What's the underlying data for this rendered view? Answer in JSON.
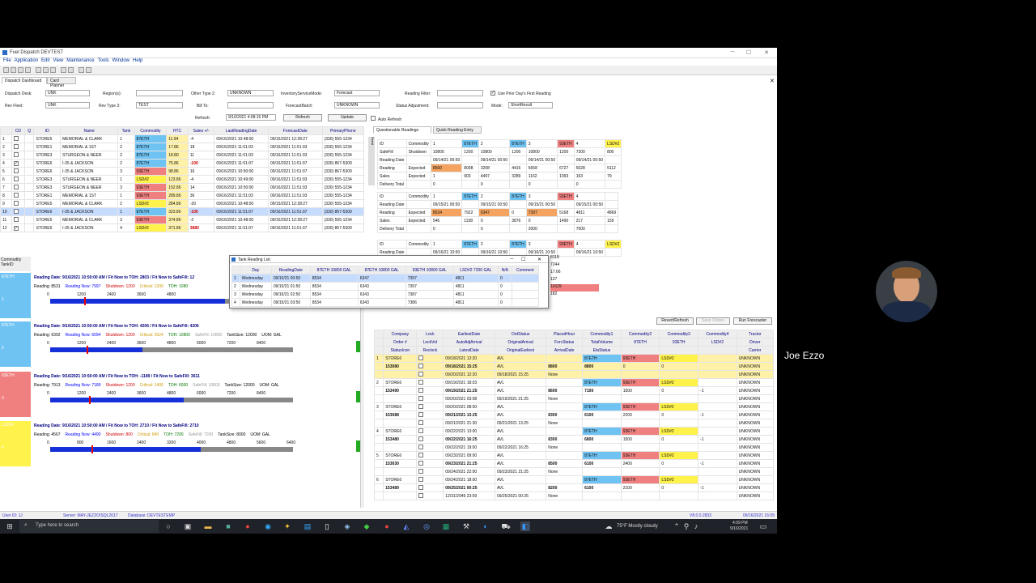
{
  "window": {
    "title": "Fuel Dispatch DEVTEST"
  },
  "menu": [
    "File",
    "Application",
    "Edit",
    "View",
    "Maintenance",
    "Tools",
    "Window",
    "Help"
  ],
  "doc_tabs": [
    "Dispatch Dashboard",
    "Card Planner"
  ],
  "filters": {
    "dispatch_desk_label": "Dispatch Desk:",
    "dispatch_desk_value": "UNK",
    "region_label": "Region(s):",
    "other_type_label": "Other Type 2:",
    "other_type_value": "UNKNOWN",
    "inventory_mode_label": "InventoryServiceMode:",
    "inventory_mode_value": "Forecast",
    "reading_filter_label": "Reading Filter:",
    "use_prior_label": "Use Prior Day's First Reading",
    "rev_fleet_label": "Rev Fleet:",
    "rev_fleet_value": "UNK",
    "rev_type_label": "Rev Type 3:",
    "rev_type_value": "TEST",
    "bill_to_label": "Bill To:",
    "forecast_batch_label": "ForecastBatch:",
    "forecast_batch_value": "UNKNOWN",
    "status_adj_label": "Status Adjustment:",
    "mode_label": "Mode:",
    "mode_value": "ShortResult",
    "refresh_label": "Refresh:",
    "refresh_value": "9/16/2021 4:08:15 PM",
    "refresh_button": "Refresh",
    "update_button": "Update",
    "auto_refresh_label": "Auto Refresh"
  },
  "tank_grid": {
    "headers": [
      "CD",
      "Q",
      "ID",
      "Name",
      "Tank",
      "Commodity",
      "HTC",
      "Sales +/-",
      "LastReadingDate",
      "ForecastDate",
      "PrimaryPhone"
    ],
    "rows": [
      [
        "1",
        "STORE5",
        "MEMORIAL & CLARK",
        "1",
        "87ETH",
        "11.94",
        "-4",
        "09/16/2021 10:48:00",
        "09/15/2021 12:28:27",
        "(330) 555-1234"
      ],
      [
        "2",
        "STORE1",
        "MEMORIAL & 1ST",
        "2",
        "87ETH",
        "17.86",
        "18",
        "09/16/2021 11:51:03",
        "09/16/2021 11:51:03",
        "(330) 555-1234"
      ],
      [
        "3",
        "STORE3",
        "STURGEON & NEER",
        "2",
        "87ETH",
        "18.80",
        "11",
        "09/16/2021 11:51:03",
        "09/16/2021 11:51:03",
        "(330) 555-1234"
      ],
      [
        "4",
        "STORE6",
        "I-35 & JACKSON",
        "2",
        "87ETH",
        "75.86",
        "-100",
        "09/16/2021 11:51:07",
        "09/16/2021 11:51:07",
        "(330) 867-5309"
      ],
      [
        "5",
        "STORE6",
        "I-35 & JACKSON",
        "3",
        "93ETH",
        "98.86",
        "16",
        "09/16/2021 10:50:00",
        "09/16/2021 11:51:07",
        "(330) 867-5309"
      ],
      [
        "6",
        "STORE3",
        "STURGEON & NEER",
        "1",
        "LSD#2",
        "123.86",
        "-4",
        "09/16/2021 10:49:00",
        "09/16/2021 11:51:03",
        "(330) 555-1234"
      ],
      [
        "7",
        "STORE3",
        "STURGEON & NEER",
        "3",
        "93ETH",
        "152.86",
        "14",
        "09/16/2021 10:50:00",
        "09/16/2021 11:51:03",
        "(330) 555-1234"
      ],
      [
        "8",
        "STORE1",
        "MEMORIAL & 1ST",
        "1",
        "93ETH",
        "289.86",
        "36",
        "09/16/2021 11:51:03",
        "09/16/2021 11:51:03",
        "(330) 555-1234"
      ],
      [
        "9",
        "STORE5",
        "MEMORIAL & CLARK",
        "2",
        "LSD#2",
        "284.86",
        "-20",
        "09/16/2021 10:48:00",
        "09/15/2021 12:28:27",
        "(330) 555-1234"
      ],
      [
        "10",
        "STORE6",
        "I-35 & JACKSON",
        "1",
        "87ETH",
        "323.86",
        "-100",
        "09/16/2021 11:51:07",
        "09/16/2021 11:51:07",
        "(330) 867-5309"
      ],
      [
        "11",
        "STORE5",
        "MEMORIAL & CLARK",
        "3",
        "93ETH",
        "374.86",
        "-2",
        "09/16/2021 10:48:00",
        "09/15/2021 12:28:27",
        "(330) 555-1234"
      ],
      [
        "12",
        "STORE6",
        "I-35 & JACKSON",
        "4",
        "LSD#2",
        "371.86",
        "3880",
        "09/16/2021 11:51:07",
        "09/16/2021 11:51:07",
        "(330) 867-5309"
      ]
    ]
  },
  "tanks": [
    {
      "id": "87ETH",
      "num": "1",
      "line1": "Reading Date: 9/16/2021 10:50:00 AM  /  Fit Now to TOH: 2803  /  Fit Now to SafeFill: 12",
      "line2a": "Reading: 8531",
      "line2b": "Reading Now: 7997",
      "line2c": "Shutdown: 1200",
      "line2d": "Critical: 1200",
      "line2e": "TOH: 1080",
      "ticks": [
        "0",
        "1200",
        "2400",
        "3600",
        "4800"
      ],
      "fill": 0.72
    },
    {
      "id": "87ETH",
      "num": "2",
      "line1": "Reading Date: 9/16/2021 10:50:00 AM  /  Fit Now to TOH: 4206  /  Fit Now to SafeFill: 4206",
      "line2a": "Reading: 6302",
      "line2b": "Reading Now: 6094",
      "line2c": "Shutdown: 1200",
      "line2d": "Critical: 2624",
      "line2e": "TOH: 10800",
      "line2f": "SafeFill: 10800",
      "line2g": "TankSize: 12000",
      "line2h": "UOM: GAL",
      "ticks": [
        "0",
        "1200",
        "2400",
        "3600",
        "4800",
        "6000",
        "7200",
        "8400"
      ],
      "fill": 0.38
    },
    {
      "id": "93ETH",
      "num": "3",
      "line1": "Reading Date: 9/16/2021 10:50:00 AM  /  Fit Now to TOH: -1189  /  Fit Now to SafeFill: 3611",
      "line2a": "Reading: 7913",
      "line2b": "Reading Now: 7189",
      "line2c": "Shutdown: 1200",
      "line2d": "Critical: 1400",
      "line2e": "TOH: 6000",
      "line2f": "SafeFill: 10800",
      "line2g": "TankSize: 12000",
      "line2h": "UOM: GAL",
      "ticks": [
        "0",
        "1200",
        "2400",
        "3600",
        "4800",
        "6000",
        "7200",
        "8400"
      ],
      "fill": 0.55
    },
    {
      "id": "LSD#2",
      "num": "4",
      "line1": "Reading Date: 9/16/2021 10:50:00 AM  /  Fit Now to TOH: 2710  /  Fit Now to SafeFill: 2710",
      "line2a": "Reading: 4567",
      "line2b": "Reading Now: 4490",
      "line2c": "Shutdown: 800",
      "line2d": "Critical: 840",
      "line2e": "TOH: 7200",
      "line2f": "SafeFill: 7200",
      "line2g": "TankSize: 8000",
      "line2h": "UOM: GAL",
      "ticks": [
        "0",
        "800",
        "1600",
        "2400",
        "3200",
        "4000",
        "4800",
        "5600",
        "6400"
      ],
      "fill": 0.62
    }
  ],
  "tank_side_header": {
    "commodity": "Commodity",
    "tank_id": "TankID"
  },
  "qr_tabs": [
    "Questionable Readings",
    "Quick Reading Entry"
  ],
  "qr_blocks": [
    {
      "labels": [
        "ID",
        "SafeFill",
        "Reading Date",
        "Reading",
        "Sales",
        "Delivery Total"
      ],
      "header": [
        "Commodity",
        "1",
        "87ETH",
        "2",
        "87ETH",
        "3",
        "93ETH",
        "4",
        "LSD#2"
      ],
      "rows": [
        [
          "Shutdown",
          "10800",
          "1200",
          "10800",
          "1200",
          "10800",
          "1200",
          "7200",
          "800"
        ],
        [
          "",
          "09/14/21 00:50",
          "",
          "09/14/21 00:50",
          "",
          "09/14/21 00:50",
          "",
          "09/14/21 00:50",
          ""
        ],
        [
          "Expected",
          "8560",
          "8098",
          "3208",
          "4416",
          "6658",
          "6727",
          "5028",
          "5112"
        ],
        [
          "Expected",
          "1",
          "903",
          "4497",
          "3289",
          "1162",
          "1093",
          "163",
          "79"
        ],
        [
          "",
          "0",
          "",
          "0",
          "",
          "0",
          "",
          "0",
          ""
        ]
      ]
    },
    {
      "labels": [
        "ID",
        "Reading Date",
        "Reading",
        "Sales",
        "Delivery Total"
      ],
      "header": [
        "Commodity",
        "1",
        "87ETH",
        "2",
        "87ETH",
        "3",
        "93ETH",
        "4",
        ""
      ],
      "rows": [
        [
          "",
          "09/15/21 00:50",
          "",
          "09/15/21 00:50",
          "",
          "09/15/21 00:50",
          "",
          "09/15/21 00:50",
          ""
        ],
        [
          "Expected",
          "8534",
          "7922",
          "6347",
          "0",
          "7397",
          "5168",
          "4811",
          "4869"
        ],
        [
          "Expected",
          "546",
          "1158",
          "0",
          "3876",
          "0",
          "1490",
          "217",
          "159"
        ],
        [
          "",
          "0",
          "",
          "0",
          "",
          "2000",
          "",
          "7000",
          ""
        ]
      ]
    },
    {
      "labels": [
        "ID",
        "Reading Date"
      ],
      "header": [
        "Commodity",
        "1",
        "87ETH",
        "2",
        "87ETH",
        "3",
        "93ETH",
        "4",
        "LSD#2"
      ],
      "rows": [
        [
          "",
          "09/16/21 10:50",
          "",
          "09/16/21 10:50",
          "",
          "09/16/21 10:50",
          "",
          "09/16/21 10:50",
          ""
        ]
      ]
    }
  ],
  "popup": {
    "title": "Tank Reading List",
    "headers": [
      "Day",
      "ReadingDate",
      "87ETH 10800 GAL",
      "87ETH 10800 GAL",
      "93ETH 10800 GAL",
      "LSD#2 7200 GAL",
      "N/A",
      "Comment"
    ],
    "rows": [
      [
        "1",
        "Wednesday",
        "09/15/21 00:50",
        "8534",
        "6347",
        "7397",
        "4811",
        "0"
      ],
      [
        "2",
        "Wednesday",
        "09/15/21 01:50",
        "8534",
        "6343",
        "7397",
        "4811",
        "0"
      ],
      [
        "3",
        "Wednesday",
        "09/15/21 02:50",
        "8534",
        "6343",
        "7387",
        "4811",
        "0"
      ],
      [
        "4",
        "Wednesday",
        "09/15/21 03:50",
        "8534",
        "6343",
        "7386",
        "4811",
        "0"
      ]
    ],
    "side_values": [
      "8118",
      "7244",
      "17.66",
      "127",
      "11629",
      "182"
    ]
  },
  "order_buttons": [
    "Revert/Refresh",
    "Save Orders",
    "Run Forecaster"
  ],
  "order_grid": {
    "headers1": [
      "Company",
      "Lock",
      "EarliestDate",
      "OrdStatus",
      "PlacedHour",
      "Commodity1",
      "Commodity2",
      "Commodity3",
      "Commodity4",
      "Tractor"
    ],
    "headers2": [
      "Order #",
      "LockVol",
      "AutoAdjArrival",
      "OriginalArrival",
      "ForcStatus",
      "TotalVolume",
      "87ETH",
      "93ETH",
      "LSD#2",
      "Driver"
    ],
    "headers3": [
      "StatusIcon",
      "Reclock",
      "LatestDate",
      "OriginalEarliest",
      "ArrivalDate",
      "EtaStatus",
      "",
      "",
      "",
      "Carrier"
    ],
    "groups": [
      {
        "num": "1",
        "rows": [
          [
            "STORE6",
            "",
            "09/18/2021 12:20",
            "AVL",
            "",
            "87ETH",
            "93ETH",
            "LSD#2",
            "",
            "UNKNOWN"
          ],
          [
            "153080",
            "",
            "09/18/2021 15:25",
            "AVL",
            "8800",
            "8800",
            "0",
            "0",
            "",
            "UNKNOWN"
          ],
          [
            "",
            "",
            "09/20/2021 12:20",
            "09/18/2021 15:25",
            "None",
            "",
            "",
            "",
            "",
            "UNKNOWN"
          ]
        ]
      },
      {
        "num": "2",
        "rows": [
          [
            "STORE6",
            "",
            "09/19/2021 18:03",
            "AVL",
            "",
            "87ETH",
            "93ETH",
            "LSD#2",
            "",
            "UNKNOWN"
          ],
          [
            "153490",
            "",
            "09/19/2021 21:25",
            "AVL",
            "8600",
            "7100",
            "1500",
            "0",
            "-1",
            "UNKNOWN"
          ],
          [
            "",
            "",
            "09/20/2021 03:08",
            "09/19/2021 21:25",
            "None",
            "",
            "",
            "",
            "",
            "UNKNOWN"
          ]
        ]
      },
      {
        "num": "3",
        "rows": [
          [
            "STORE6",
            "",
            "09/20/2021 08:00",
            "AVL",
            "",
            "87ETH",
            "93ETH",
            "LSD#2",
            "",
            "UNKNOWN"
          ],
          [
            "153088",
            "",
            "09/21/2021 13:25",
            "AVL",
            "8300",
            "6100",
            "2200",
            "0",
            "-1",
            "UNKNOWN"
          ],
          [
            "",
            "",
            "09/21/2021 21:30",
            "09/21/2021 13:25",
            "None",
            "",
            "",
            "",
            "",
            "UNKNOWN"
          ]
        ]
      },
      {
        "num": "4",
        "rows": [
          [
            "STORE6",
            "",
            "09/22/2021 13:00",
            "AVL",
            "",
            "87ETH",
            "93ETH",
            "LSD#2",
            "",
            "UNKNOWN"
          ],
          [
            "153480",
            "",
            "09/22/2021 16:25",
            "AVL",
            "8300",
            "6800",
            "1500",
            "0",
            "-1",
            "UNKNOWN"
          ],
          [
            "",
            "",
            "09/22/2021 19:00",
            "09/22/2021 16:25",
            "None",
            "",
            "",
            "",
            "",
            "UNKNOWN"
          ]
        ]
      },
      {
        "num": "5",
        "rows": [
          [
            "STORE6",
            "",
            "09/23/2021 09:00",
            "AVL",
            "",
            "87ETH",
            "93ETH",
            "LSD#2",
            "",
            "UNKNOWN"
          ],
          [
            "153030",
            "",
            "09/23/2021 21:25",
            "AVL",
            "8500",
            "6100",
            "2400",
            "0",
            "-1",
            "UNKNOWN"
          ],
          [
            "",
            "",
            "09/24/2021 22:00",
            "09/23/2021 21:25",
            "None",
            "",
            "",
            "",
            "",
            "UNKNOWN"
          ]
        ]
      },
      {
        "num": "6",
        "rows": [
          [
            "STORE6",
            "",
            "09/24/2021 18:00",
            "AVL",
            "",
            "87ETH",
            "93ETH",
            "LSD#2",
            "",
            "UNKNOWN"
          ],
          [
            "153489",
            "",
            "09/25/2021 00:25",
            "AVL",
            "8200",
            "6100",
            "2100",
            "0",
            "-1",
            "UNKNOWN"
          ],
          [
            "",
            "",
            "12/31/2049 23:59",
            "09/25/2021 00:25",
            "None",
            "",
            "",
            "",
            "",
            "UNKNOWN"
          ]
        ]
      }
    ]
  },
  "status": {
    "user": "User ID: JJ",
    "server": "Server: MAY-JEZZO\\SQL2017",
    "database": "Database: DEVTESTEMP",
    "version": "V8.0.0.2833",
    "datetime": "09/16/2021 16:09"
  },
  "taskbar": {
    "search_placeholder": "Type here to search",
    "weather": "75°F  Mostly cloudy",
    "time": "4:09 PM",
    "date": "9/16/2021"
  },
  "webcam": {
    "name": "Joe Ezzo"
  },
  "colors": {
    "accent": "#000080",
    "ethanol87": "#6fc3f2",
    "ethanol93": "#f08080",
    "diesel": "#fff24a",
    "fill_bar": "#1530d8"
  }
}
